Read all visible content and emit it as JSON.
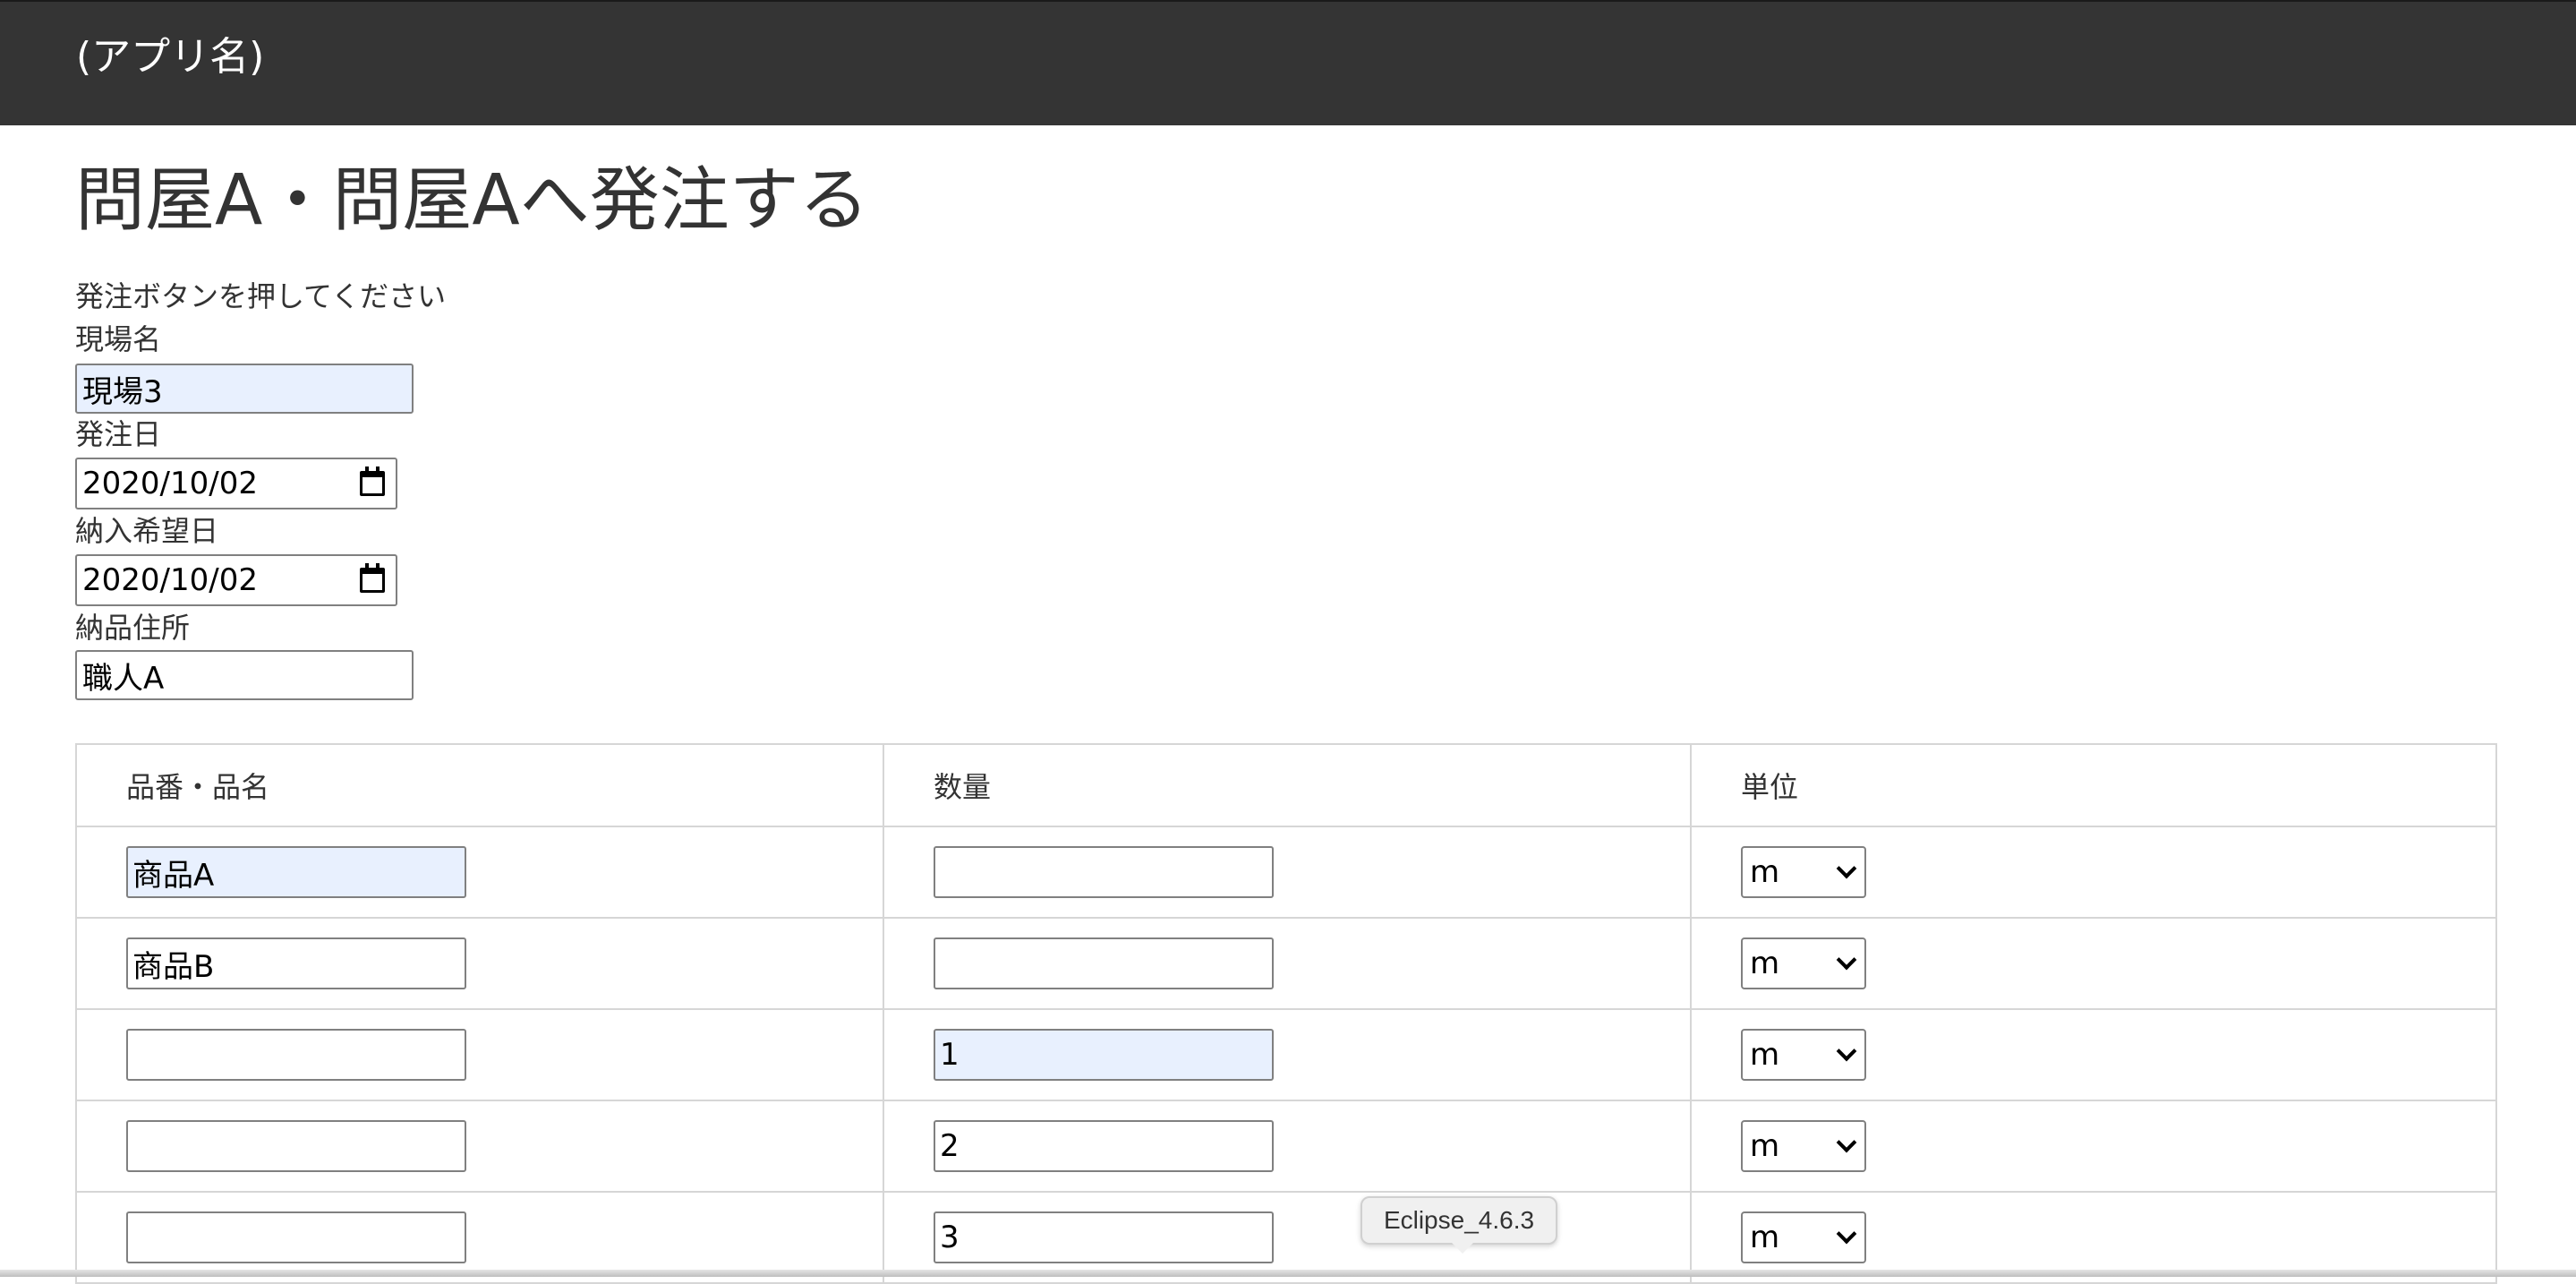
{
  "header": {
    "app_name": "(アプリ名)"
  },
  "page": {
    "title": "問屋A・問屋Aへ発注する",
    "instruction": "発注ボタンを押してください"
  },
  "form": {
    "site_name": {
      "label": "現場名",
      "value": "現場3"
    },
    "order_date": {
      "label": "発注日",
      "value": "2020/10/02"
    },
    "desired_delivery_date": {
      "label": "納入希望日",
      "value": "2020/10/02"
    },
    "delivery_address": {
      "label": "納品住所",
      "value": "職人A"
    }
  },
  "table": {
    "headers": [
      "品番・品名",
      "数量",
      "単位"
    ],
    "rows": [
      {
        "item": "商品A",
        "quantity": "",
        "unit": "m"
      },
      {
        "item": "商品B",
        "quantity": "",
        "unit": "m"
      },
      {
        "item": "",
        "quantity": "1",
        "unit": "m"
      },
      {
        "item": "",
        "quantity": "2",
        "unit": "m"
      },
      {
        "item": "",
        "quantity": "3",
        "unit": "m"
      }
    ]
  },
  "tooltip": {
    "text": "Eclipse_4.6.3"
  },
  "colors": {
    "header_bg": "#343434",
    "autofill_bg": "#e8f0fe"
  }
}
